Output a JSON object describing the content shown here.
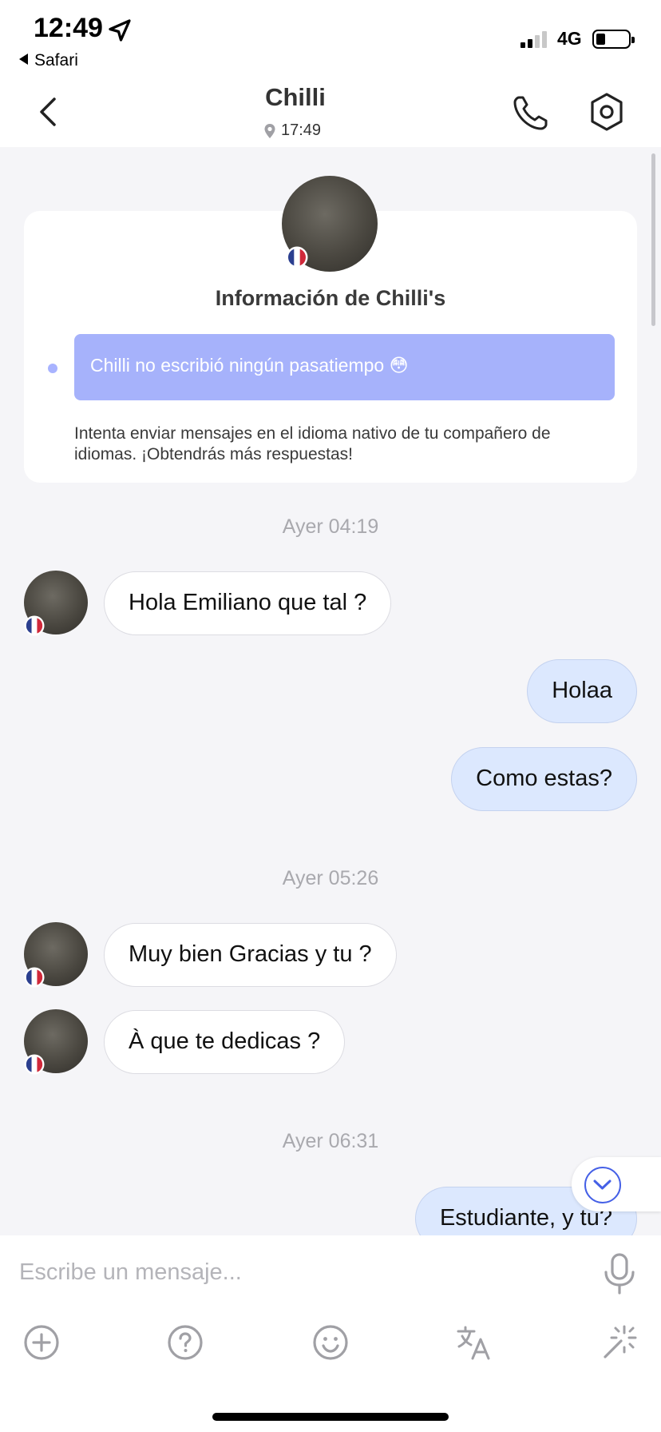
{
  "status_bar": {
    "time": "12:49",
    "back_app": "Safari",
    "network": "4G"
  },
  "header": {
    "title": "Chilli",
    "local_time": "17:49"
  },
  "info_card": {
    "title": "Información de Chilli's",
    "hobby_text": "Chilli no escribió ningún pasatiempo 😳",
    "tip": "Intenta enviar mensajes en el idioma nativo de tu compañero de idiomas. ¡Obtendrás más respuestas!"
  },
  "timestamps": [
    "Ayer 04:19",
    "Ayer 05:26",
    "Ayer 06:31"
  ],
  "messages": [
    {
      "from": "them",
      "text": "Hola Emiliano que tal ?"
    },
    {
      "from": "me",
      "text": "Holaa"
    },
    {
      "from": "me",
      "text": "Como estas?"
    },
    {
      "from": "them",
      "text": "Muy bien Gracias y tu ?"
    },
    {
      "from": "them",
      "text": "À que te dedicas ?"
    },
    {
      "from": "me",
      "text": "Estudiante, y tu?"
    }
  ],
  "composer": {
    "placeholder": "Escribe un mensaje..."
  },
  "icons": {
    "back": "chevron-left-icon",
    "call": "phone-icon",
    "settings": "settings-icon",
    "mic": "microphone-icon",
    "tools": [
      "plus-circle-icon",
      "question-circle-icon",
      "smiley-icon",
      "translate-icon",
      "magic-wand-icon"
    ]
  },
  "colors": {
    "outgoing_bubble": "#dce8fe",
    "incoming_bubble": "#ffffff",
    "hobby_bg": "#a6b2fb",
    "accent": "#4560e6",
    "chat_bg": "#f5f5f8"
  }
}
